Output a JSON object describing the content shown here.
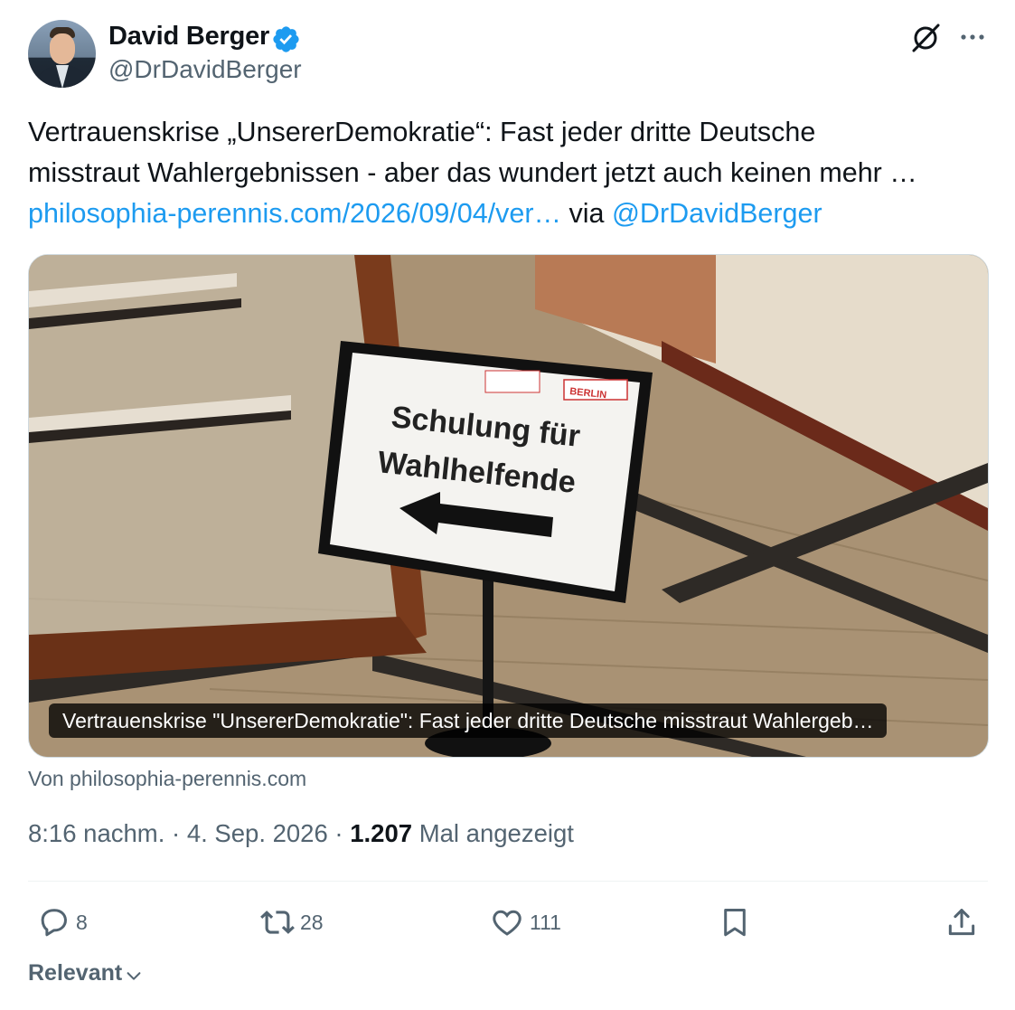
{
  "author": {
    "name": "David Berger",
    "handle": "@DrDavidBerger",
    "verified_color": "#1d9bf0"
  },
  "header_icons": [
    "grok-icon",
    "more-icon"
  ],
  "tweet": {
    "line1": "Vertrauenskrise „UnsererDemokratie“: Fast jeder dritte Deutsche",
    "line2": "misstraut Wahlergebnissen - aber das wundert jetzt auch keinen mehr …",
    "link_text": "philosophia-perennis.com/2026/09/04/ver…",
    "via": " via ",
    "mention": "@DrDavidBerger"
  },
  "card": {
    "caption": "Vertrauenskrise \"UnsererDemokratie\": Fast jeder dritte Deutsche misstraut Wahlergeb…",
    "source": "Von philosophia-perennis.com",
    "sign": {
      "title_line1": "Schulung für",
      "title_line2": "Wahlhelfende",
      "logo_text": "BERLIN"
    }
  },
  "meta": {
    "time": "8:16 nachm.",
    "sep1": " · ",
    "date": "4. Sep. 2026",
    "sep2": " · ",
    "views_count": "1.207",
    "views_label": " Mal angezeigt"
  },
  "actions": {
    "replies": "8",
    "reposts": "28",
    "likes": "111"
  },
  "sort": {
    "label": "Relevant"
  },
  "colors": {
    "text": "#0f1419",
    "secondary": "#536471",
    "link": "#1d9bf0",
    "border": "#cfd9de"
  }
}
